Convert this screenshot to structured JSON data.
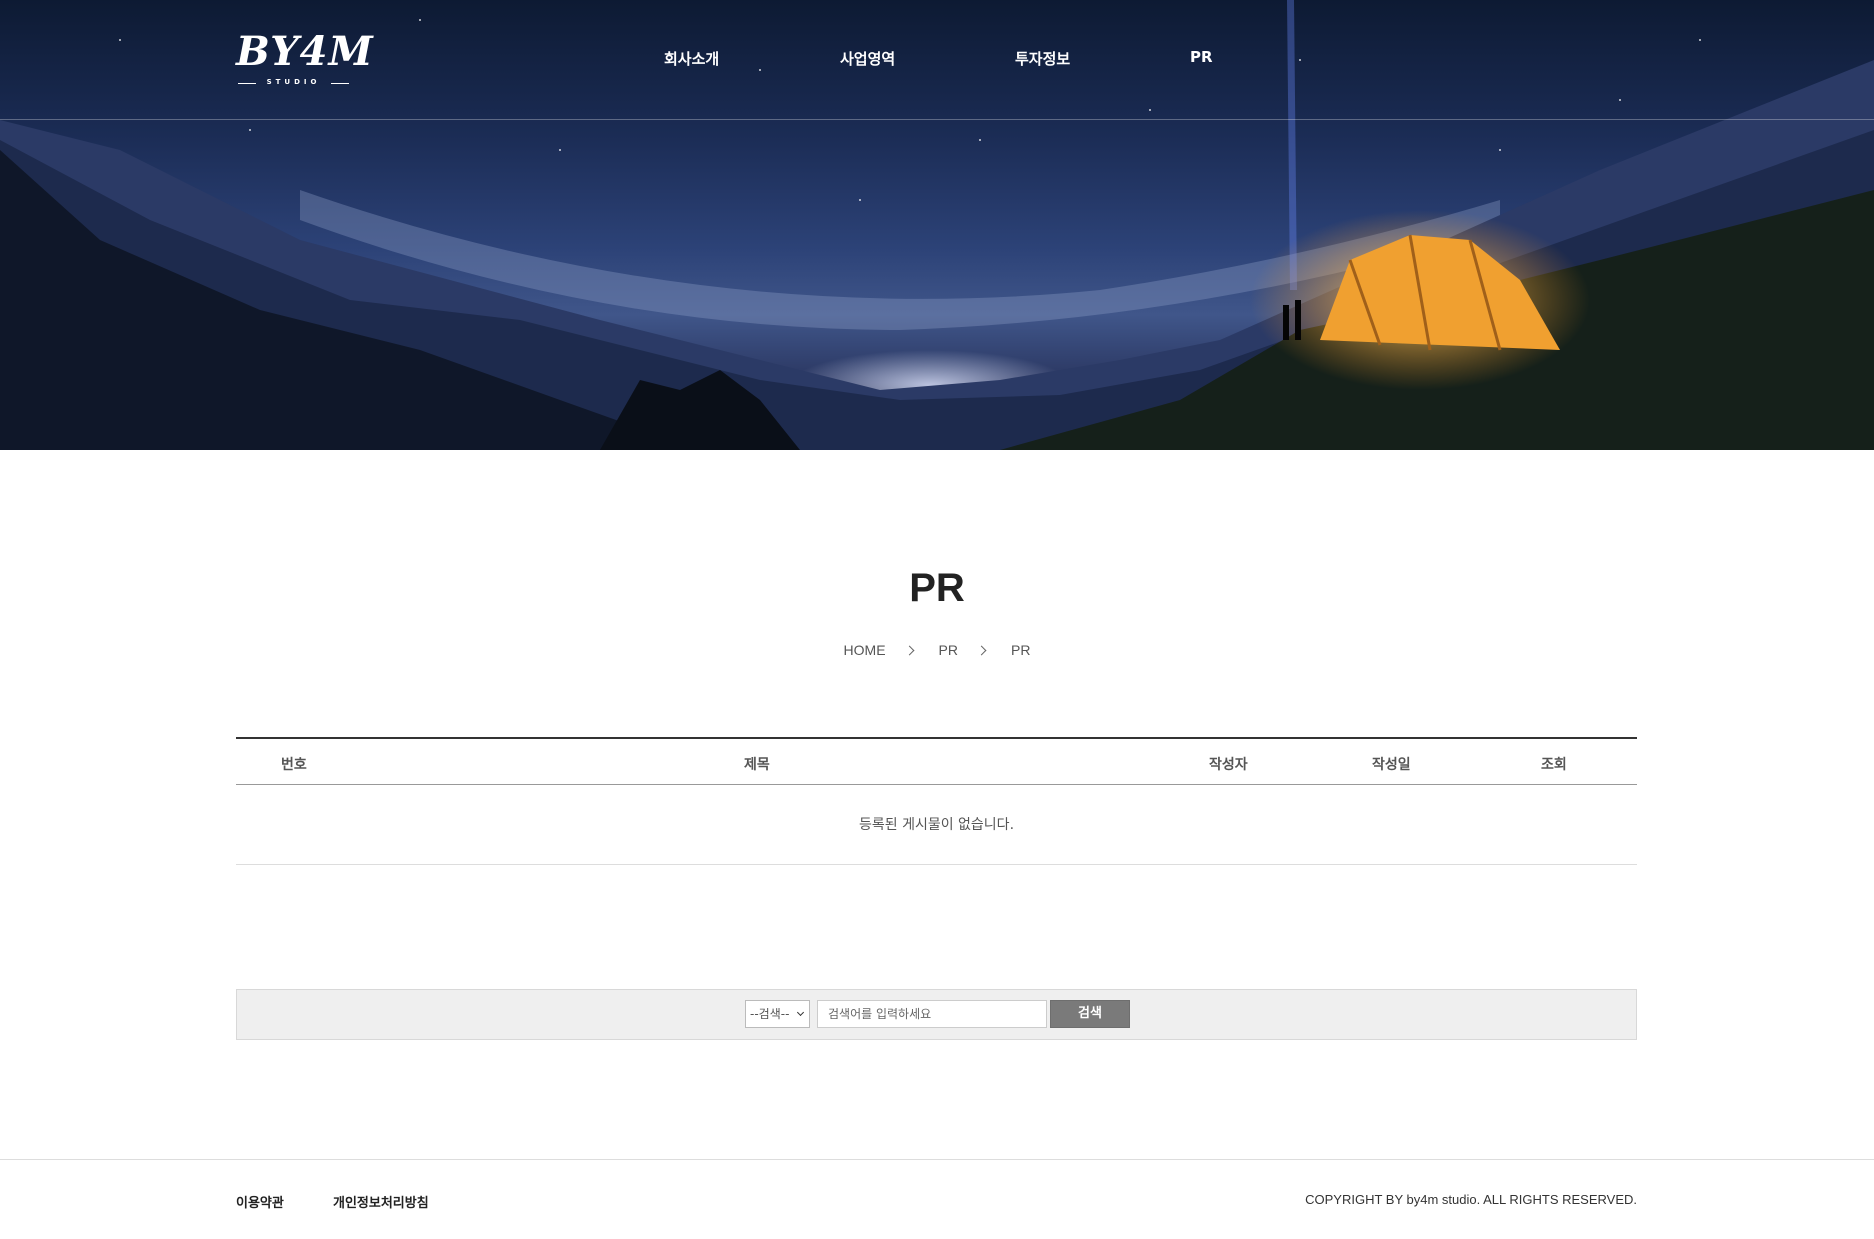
{
  "header": {
    "logo_text": "BY4M",
    "logo_sub": "STUDIO",
    "nav": [
      "회사소개",
      "사업영역",
      "투자정보",
      "PR"
    ]
  },
  "page": {
    "title": "PR",
    "breadcrumb": [
      "HOME",
      "PR",
      "PR"
    ]
  },
  "board": {
    "columns": [
      "번호",
      "제목",
      "작성자",
      "작성일",
      "조회"
    ],
    "empty_message": "등록된 게시물이 없습니다."
  },
  "search": {
    "select_value": "--검색--",
    "input_placeholder": "검색어를 입력하세요",
    "button_label": "검색"
  },
  "footer": {
    "terms_label": "이용약관",
    "privacy_label": "개인정보처리방침",
    "copyright": "COPYRIGHT BY by4m studio. ALL RIGHTS RESERVED."
  },
  "colors": {
    "sky_top": "#0d1a33",
    "tent": "#f0a030",
    "search_button": "#7a7a7a"
  }
}
